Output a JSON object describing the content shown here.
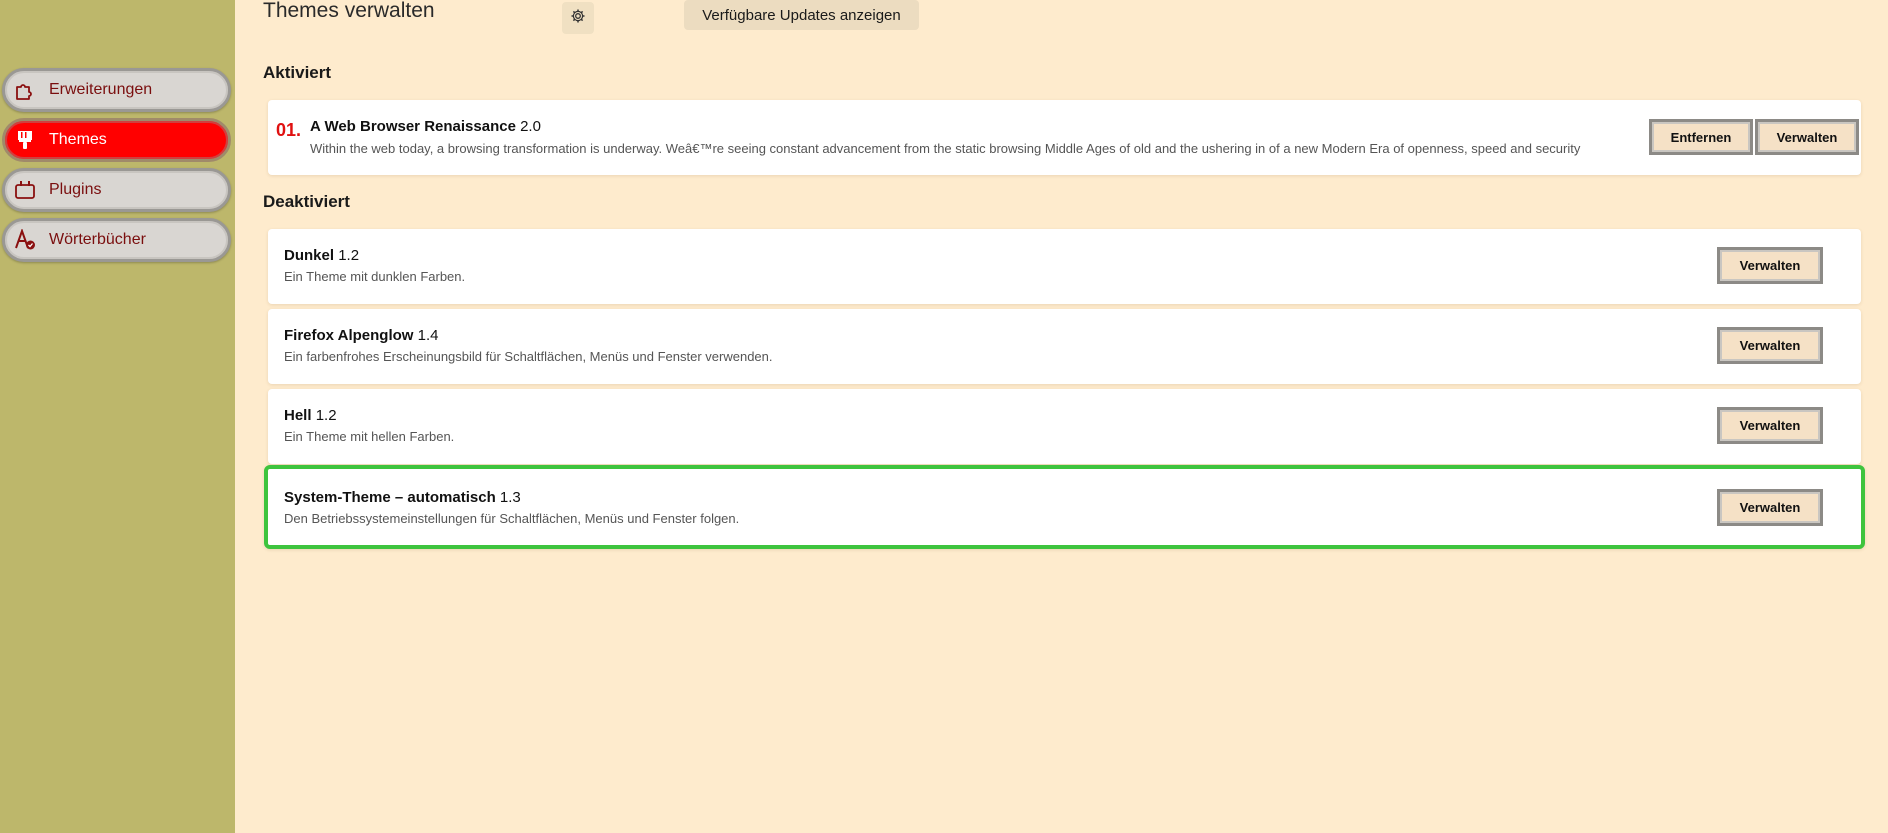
{
  "sidebar": {
    "items": [
      {
        "label": "Erweiterungen",
        "icon": "puzzle-icon"
      },
      {
        "label": "Themes",
        "icon": "brush-icon"
      },
      {
        "label": "Plugins",
        "icon": "plugin-icon"
      },
      {
        "label": "Wörterbücher",
        "icon": "dictionary-icon"
      }
    ],
    "active": "Themes"
  },
  "header": {
    "title": "Themes verwalten",
    "updates_button": "Verfügbare Updates anzeigen"
  },
  "sections": {
    "enabled_title": "Aktiviert",
    "disabled_title": "Deaktiviert"
  },
  "enabled": [
    {
      "rank": "01.",
      "name": "A Web Browser Renaissance",
      "version": "2.0",
      "description": "Within the web today, a browsing transformation is underway. Weâ€™re seeing constant advancement from the static browsing Middle Ages of old and the ushering in of a new Modern Era of openness, speed and security",
      "remove_label": "Entfernen",
      "manage_label": "Verwalten"
    }
  ],
  "disabled": [
    {
      "name": "Dunkel",
      "version": "1.2",
      "description": "Ein Theme mit dunklen Farben.",
      "manage_label": "Verwalten"
    },
    {
      "name": "Firefox Alpenglow",
      "version": "1.4",
      "description": "Ein farbenfrohes Erscheinungsbild für Schaltflächen, Menüs und Fenster verwenden.",
      "manage_label": "Verwalten"
    },
    {
      "name": "Hell",
      "version": "1.2",
      "description": "Ein Theme mit hellen Farben.",
      "manage_label": "Verwalten"
    },
    {
      "name": "System-Theme – automatisch",
      "version": "1.3",
      "description": "Den Betriebssystemeinstellungen für Schaltflächen, Menüs und Fenster folgen.",
      "manage_label": "Verwalten"
    }
  ],
  "colors": {
    "background": "#feebcd",
    "sidebar": "#bdb76b",
    "active_nav": "#ff0000",
    "nav_text": "#7a0e0e",
    "highlight_border": "#3ec43e",
    "rank": "#e01010"
  }
}
